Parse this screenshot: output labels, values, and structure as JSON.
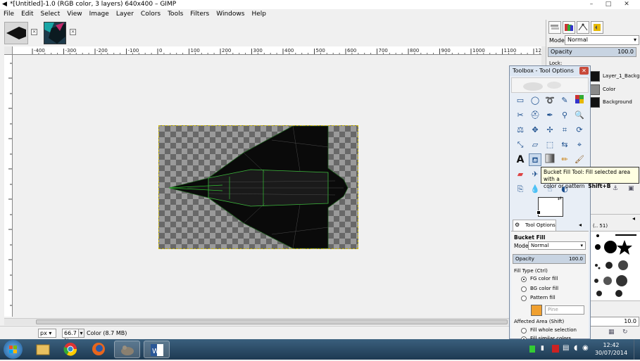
{
  "window": {
    "title": "*[Untitled]-1.0 (RGB color, 3 layers) 640x400 – GIMP",
    "minimize": "–",
    "maximize": "□",
    "close": "✕"
  },
  "menu": [
    "File",
    "Edit",
    "Select",
    "View",
    "Image",
    "Layer",
    "Colors",
    "Tools",
    "Filters",
    "Windows",
    "Help"
  ],
  "ruler": {
    "h_ticks": [
      "-400",
      "-300",
      "-200",
      "-100",
      "0",
      "100",
      "200",
      "300",
      "400",
      "500",
      "600",
      "700",
      "800",
      "900",
      "1000",
      "1100",
      "1200"
    ]
  },
  "status": {
    "unit": "px",
    "zoom": "66.7 %",
    "message": "Color (8.7 MB)"
  },
  "layers_panel": {
    "mode_label": "Mode:",
    "mode_value": "Normal",
    "opacity_label": "Opacity",
    "opacity_value": "100.0",
    "lock_label": "Lock:",
    "layers": [
      "Layer_1_Backgro",
      "Color",
      "Background"
    ]
  },
  "brushes_panel": {
    "spacing_value": "10.0",
    "label_prefix": "(.. 51)"
  },
  "toolbox": {
    "title": "Toolbox - Tool Options",
    "close": "✕",
    "tooltip_line1": "Bucket Fill Tool: Fill selected area with a",
    "tooltip_line2": "color or pattern",
    "tooltip_shortcut": "Shift+B",
    "options_tab": "Tool Options",
    "tool_name": "Bucket Fill",
    "mode_label": "Mode:",
    "mode_value": "Normal",
    "opacity_label": "Opacity",
    "opacity_value": "100.0",
    "fill_type_label": "Fill Type  (Ctrl)",
    "fill_options": [
      "FG color fill",
      "BG color fill",
      "Pattern fill"
    ],
    "pattern_name": "Pine",
    "affected_label": "Affected Area  (Shift)",
    "affected_options": [
      "Fill whole selection",
      "Fill similar colors"
    ]
  },
  "taskbar": {
    "time": "12:42",
    "date": "30/07/2014"
  },
  "colors": {
    "accent": "#1a4d8c",
    "selection": "#c8b400"
  }
}
